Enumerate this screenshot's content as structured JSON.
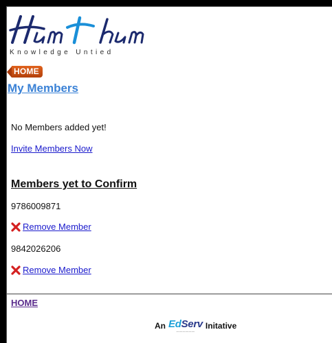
{
  "logo": {
    "wordmark": "Hum t hum",
    "tagline": "Knowledge Untied"
  },
  "nav": {
    "home_badge": "HOME"
  },
  "page": {
    "title": "My Members",
    "no_members_text": "No Members added yet!",
    "invite_link": "Invite Members Now"
  },
  "pending": {
    "heading": "Members yet to Confirm",
    "members": [
      {
        "phone": "9786009871",
        "remove_label": " Remove Member"
      },
      {
        "phone": "9842026206",
        "remove_label": " Remove Member"
      }
    ]
  },
  "footer": {
    "home_link": "HOME",
    "credit_prefix": "An",
    "credit_brand_ed": "Ed",
    "credit_brand_serv": "Serv",
    "credit_suffix": "Initative"
  },
  "colors": {
    "title_blue": "#3b82d6",
    "link_blue": "#1a1acc",
    "badge_orange": "#c94f12",
    "remove_red": "#d42020",
    "visited_purple": "#5a2b8c"
  },
  "icons": {
    "remove": "x-icon",
    "home_badge_arrow": "left-arrow-shape"
  }
}
